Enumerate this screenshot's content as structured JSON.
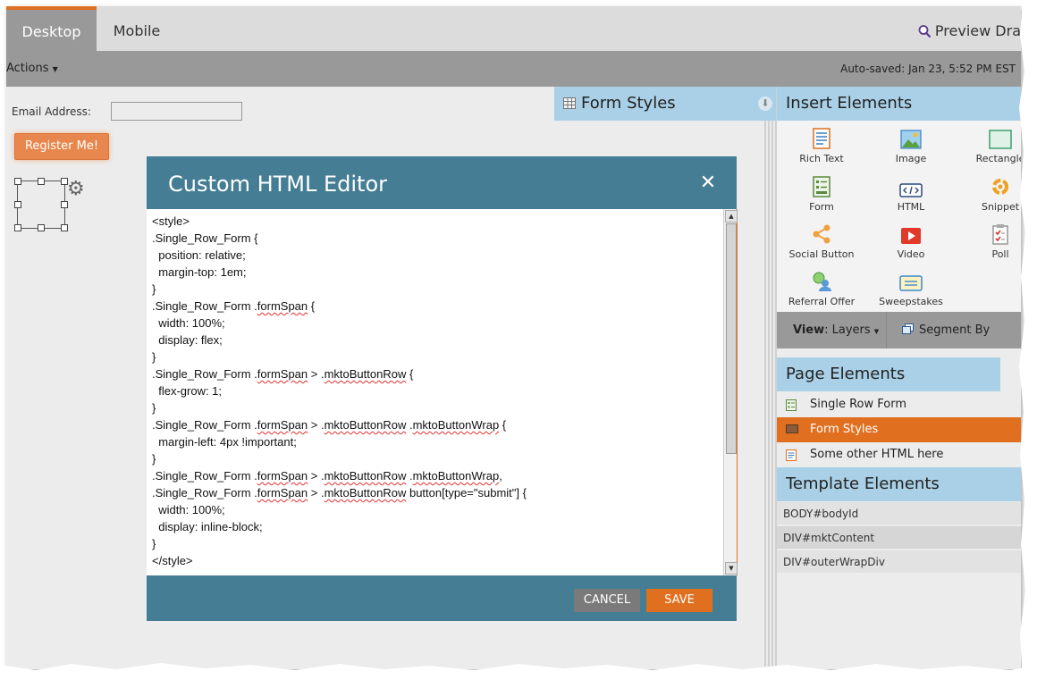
{
  "tabs": {
    "desktop": "Desktop",
    "mobile": "Mobile"
  },
  "preview": "Preview Dra",
  "toolbar": {
    "actions": "Actions",
    "autosave": "Auto-saved: Jan 23, 5:52 PM EST"
  },
  "canvas": {
    "email_label": "Email Address:",
    "email_value": "",
    "register_button": "Register Me!"
  },
  "form_styles_panel": "Form Styles",
  "insert_elements": {
    "title": "Insert Elements",
    "items": [
      {
        "label": "Rich Text",
        "icon": "rich-text-icon"
      },
      {
        "label": "Image",
        "icon": "image-icon"
      },
      {
        "label": "Rectangle",
        "icon": "rectangle-icon"
      },
      {
        "label": "Form",
        "icon": "form-icon"
      },
      {
        "label": "HTML",
        "icon": "html-icon"
      },
      {
        "label": "Snippet",
        "icon": "snippet-icon"
      },
      {
        "label": "Social Button",
        "icon": "social-button-icon"
      },
      {
        "label": "Video",
        "icon": "video-icon"
      },
      {
        "label": "Poll",
        "icon": "poll-icon"
      },
      {
        "label": "Referral Offer",
        "icon": "referral-offer-icon"
      },
      {
        "label": "Sweepstakes",
        "icon": "sweepstakes-icon"
      }
    ]
  },
  "viewbar": {
    "view_label": "View",
    "view_value": ": Layers",
    "segment": "Segment By"
  },
  "page_elements": {
    "title": "Page Elements",
    "items": [
      "Single Row Form",
      "Form Styles",
      "Some other HTML here"
    ]
  },
  "template_elements": {
    "title": "Template Elements",
    "items": [
      "BODY#bodyId",
      "DIV#mktContent",
      "DIV#outerWrapDiv"
    ]
  },
  "modal": {
    "title": "Custom HTML Editor",
    "cancel": "CANCEL",
    "save": "SAVE",
    "code_lines": [
      "<style>",
      ".Single_Row_Form {",
      "  position: relative;",
      "  margin-top: 1em;",
      "}",
      ".Single_Row_Form .formSpan {",
      "  width: 100%;",
      "  display: flex;",
      "}",
      ".Single_Row_Form .formSpan > .mktoButtonRow {",
      "  flex-grow: 1;",
      "}",
      ".Single_Row_Form .formSpan > .mktoButtonRow .mktoButtonWrap {",
      "  margin-left: 4px !important;",
      "}",
      ".Single_Row_Form .formSpan > .mktoButtonRow .mktoButtonWrap,",
      ".Single_Row_Form .formSpan > .mktoButtonRow button[type=\"submit\"] {",
      "  width: 100%;",
      "  display: inline-block;",
      "}",
      "</style>"
    ]
  },
  "colors": {
    "accent": "#e07020",
    "modal": "#457e94",
    "panel_header": "#a9d0e6"
  }
}
